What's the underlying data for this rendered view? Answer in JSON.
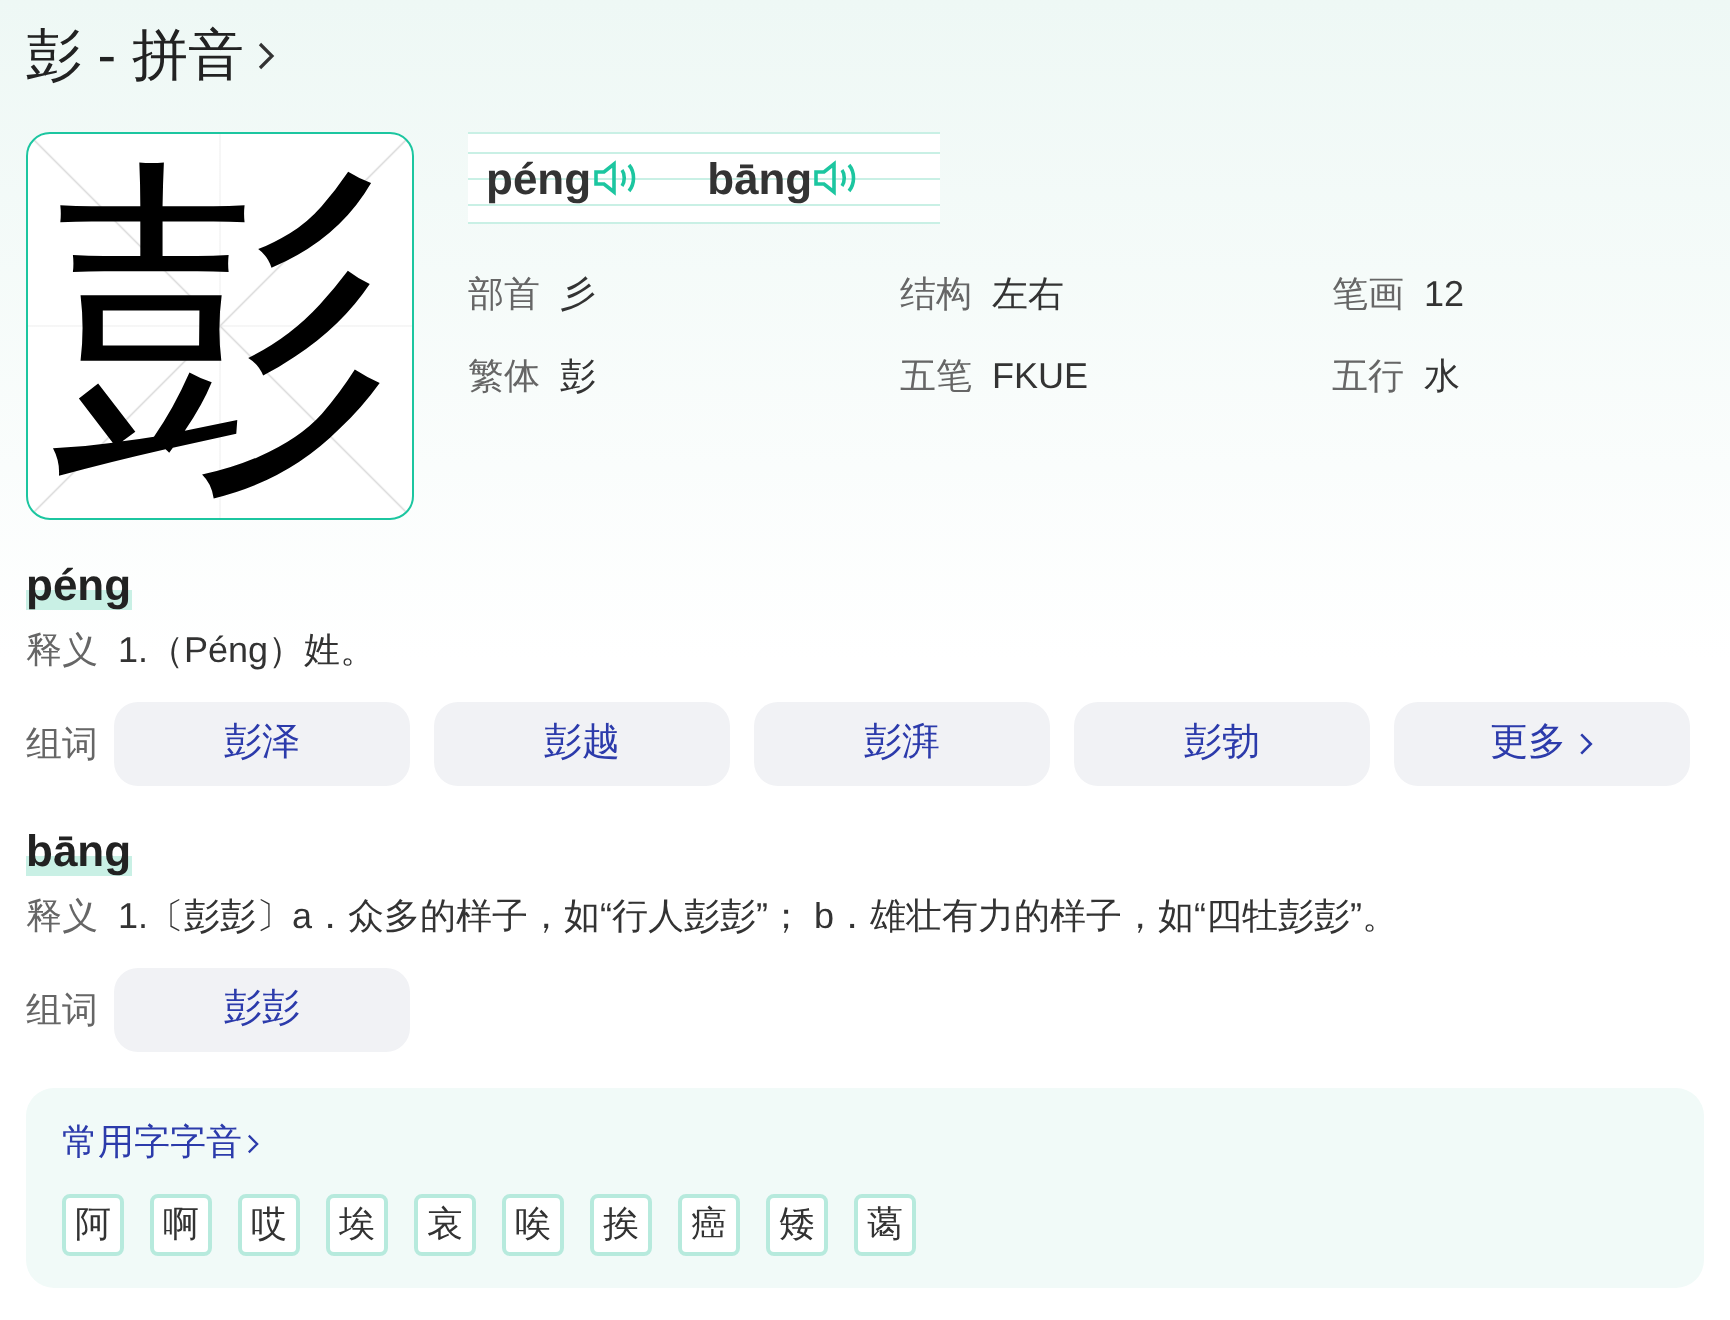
{
  "title": "彭 - 拼音",
  "character": "彭",
  "pinyins": [
    "péng",
    "bāng"
  ],
  "info": [
    {
      "label": "部首",
      "value": "彡"
    },
    {
      "label": "结构",
      "value": "左右"
    },
    {
      "label": "笔画",
      "value": "12"
    },
    {
      "label": "繁体",
      "value": "彭"
    },
    {
      "label": "五笔",
      "value": "FKUE"
    },
    {
      "label": "五行",
      "value": "水"
    }
  ],
  "readings": [
    {
      "pinyin": "péng",
      "meaning_label": "释义",
      "meaning": "1.（Péng）姓。",
      "words_label": "组词",
      "words": [
        {
          "text": "彭泽",
          "kind": "word"
        },
        {
          "text": "彭越",
          "kind": "word"
        },
        {
          "text": "彭湃",
          "kind": "word"
        },
        {
          "text": "彭勃",
          "kind": "word"
        },
        {
          "text": "更多",
          "kind": "more"
        }
      ]
    },
    {
      "pinyin": "bāng",
      "meaning_label": "释义",
      "meaning": "1.〔彭彭〕a．众多的样子，如“行人彭彭”； b．雄壮有力的样子，如“四牡彭彭”。",
      "words_label": "组词",
      "words": [
        {
          "text": "彭彭",
          "kind": "word"
        }
      ]
    }
  ],
  "common": {
    "title": "常用字字音",
    "chars": [
      "阿",
      "啊",
      "哎",
      "埃",
      "哀",
      "唉",
      "挨",
      "癌",
      "矮",
      "蔼"
    ]
  }
}
